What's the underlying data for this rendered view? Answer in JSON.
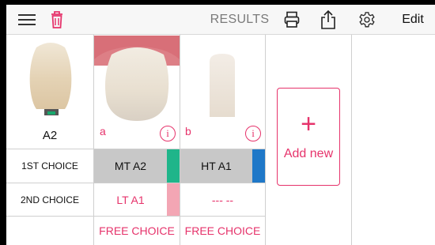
{
  "toolbar": {
    "title": "RESULTS",
    "edit_label": "Edit",
    "icons": [
      "menu-icon",
      "trash-icon",
      "print-icon",
      "share-icon",
      "settings-icon"
    ],
    "trash_color": "#e6336b"
  },
  "reference": {
    "shade": "A2"
  },
  "samples": [
    {
      "letter": "a",
      "info": "i",
      "first_choice": "MT A2",
      "first_color": "#1fb58a",
      "second_choice": "LT A1",
      "second_color": "#f3a6b4",
      "free_choice": "FREE CHOICE"
    },
    {
      "letter": "b",
      "info": "i",
      "first_choice": "HT A1",
      "first_color": "#1f78c8",
      "second_choice": "--- --",
      "free_choice": "FREE CHOICE"
    }
  ],
  "rows": {
    "first_label": "1ST CHOICE",
    "second_label": "2ND CHOICE"
  },
  "add_new": {
    "plus": "+",
    "label": "Add new"
  },
  "colors": {
    "accent": "#e6336b",
    "selected_bg": "#c8c8c8"
  }
}
